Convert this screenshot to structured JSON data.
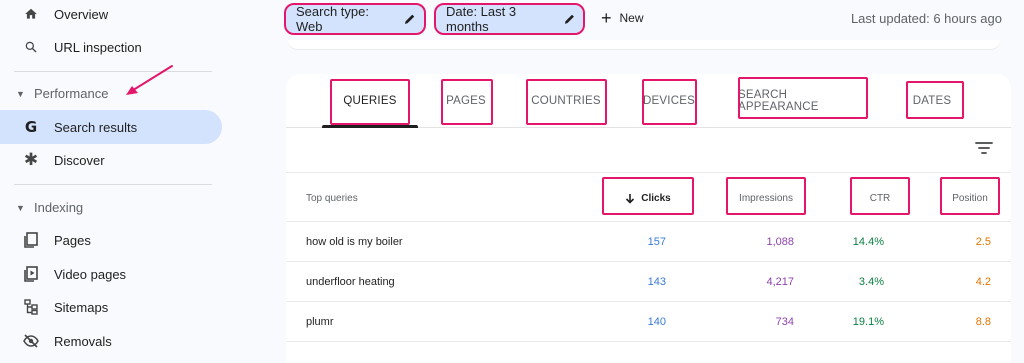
{
  "sidebar": {
    "overview": "Overview",
    "url_inspection": "URL inspection",
    "performance_section": "Performance",
    "search_results": "Search results",
    "discover": "Discover",
    "indexing_section": "Indexing",
    "pages": "Pages",
    "video_pages": "Video pages",
    "sitemaps": "Sitemaps",
    "removals": "Removals"
  },
  "toolbar": {
    "search_type": "Search type: Web",
    "date": "Date: Last 3 months",
    "new_label": "New",
    "last_updated": "Last updated: 6 hours ago"
  },
  "tabs": [
    "QUERIES",
    "PAGES",
    "COUNTRIES",
    "DEVICES",
    "SEARCH APPEARANCE",
    "DATES"
  ],
  "table": {
    "headers": {
      "query": "Top queries",
      "clicks": "Clicks",
      "impressions": "Impressions",
      "ctr": "CTR",
      "position": "Position"
    },
    "rows": [
      {
        "query": "how old is my boiler",
        "clicks": "157",
        "impressions": "1,088",
        "ctr": "14.4%",
        "position": "2.5"
      },
      {
        "query": "underfloor heating",
        "clicks": "143",
        "impressions": "4,217",
        "ctr": "3.4%",
        "position": "4.2"
      },
      {
        "query": "plumr",
        "clicks": "140",
        "impressions": "734",
        "ctr": "19.1%",
        "position": "8.8"
      }
    ]
  },
  "colors": {
    "highlight": "#e4166b",
    "active_nav": "#d3e3fd",
    "clicks": "#3a7bd5",
    "impressions": "#8e44ad",
    "ctr": "#0b8043",
    "position": "#e37400"
  }
}
